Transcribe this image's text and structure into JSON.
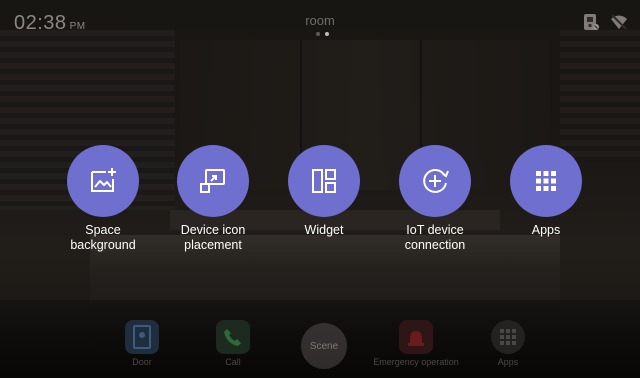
{
  "status": {
    "time": "02:38",
    "ampm": "PM",
    "room_title": "room",
    "page_dots": 2,
    "active_dot": 1,
    "icons": [
      "doorbell-icon",
      "wifi-off-icon"
    ]
  },
  "menu": {
    "items": [
      {
        "label": "Space\nbackground",
        "icon": "image-add-icon"
      },
      {
        "label": "Device icon\nplacement",
        "icon": "move-icon"
      },
      {
        "label": "Widget",
        "icon": "widget-icon"
      },
      {
        "label": "IoT device\nconnection",
        "icon": "add-circle-icon"
      },
      {
        "label": "Apps",
        "icon": "grid-icon"
      }
    ]
  },
  "dock": {
    "door": "Door",
    "call": "Call",
    "scene": "Scene",
    "emergency": "Emergency operation",
    "apps": "Apps"
  },
  "colors": {
    "accent": "#6e6fcf",
    "label": "#ffffff"
  }
}
